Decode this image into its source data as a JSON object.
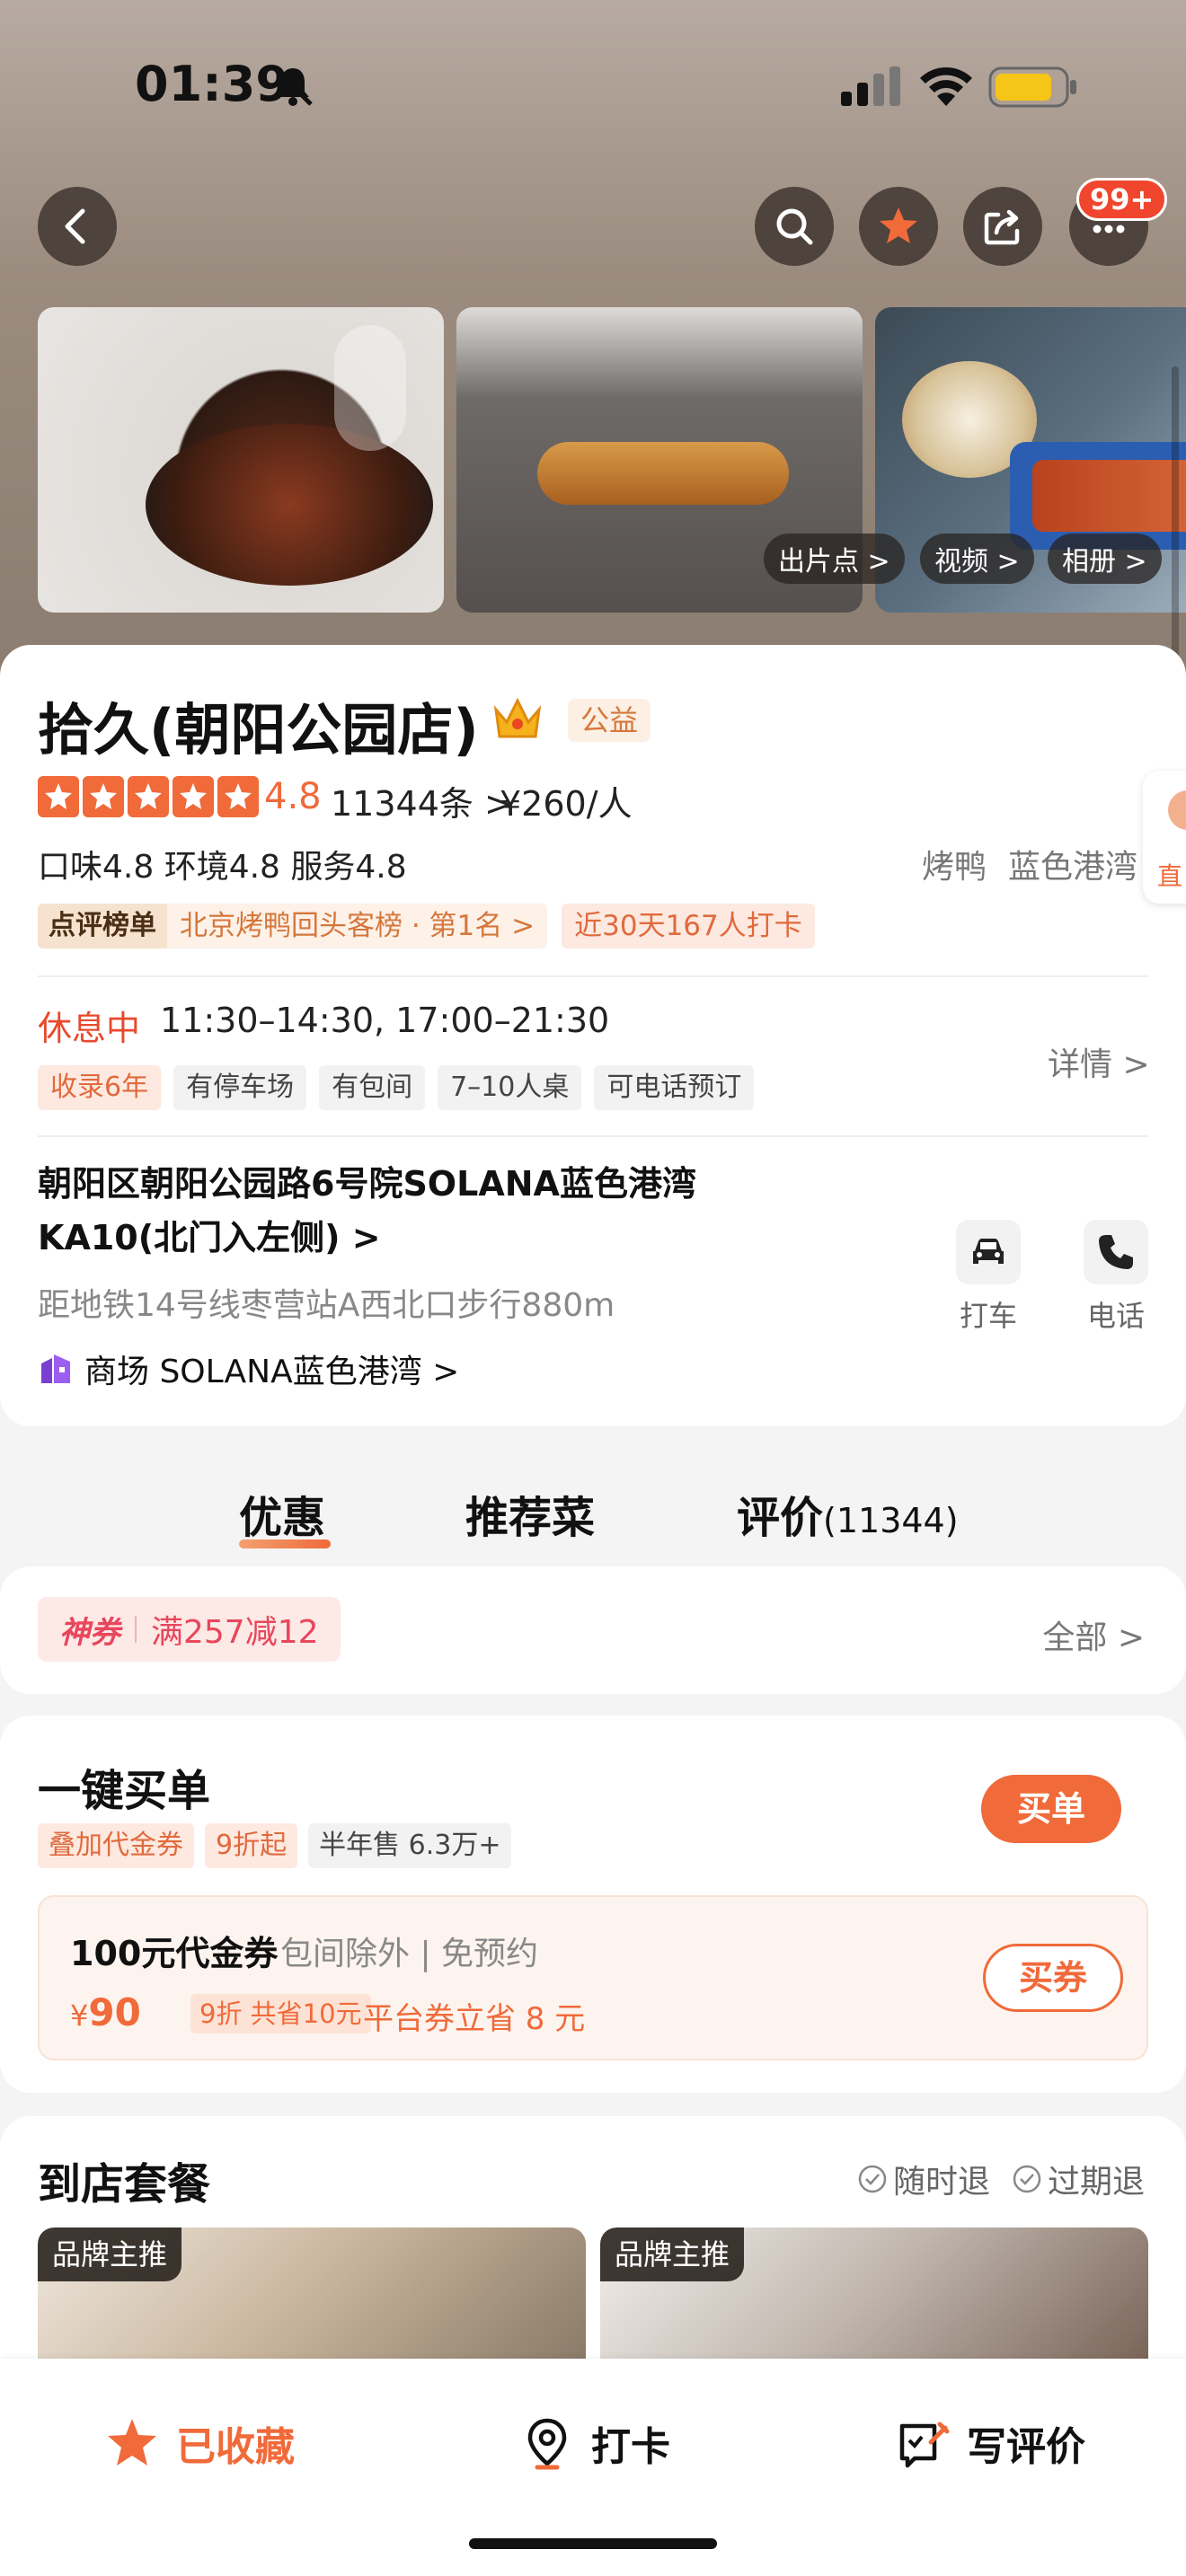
{
  "status_bar": {
    "time": "01:39"
  },
  "header": {
    "badge": "99+"
  },
  "gallery": {
    "tags": [
      "出片点 >",
      "视频 >",
      "相册 >"
    ]
  },
  "shop": {
    "name": "拾久(朝阳公园店)",
    "badge": "公益",
    "rating": "4.8",
    "review_count": "11344条 >",
    "price": "¥260/人",
    "scores": "口味4.8  环境4.8  服务4.8",
    "categories": [
      "烤鸭",
      "蓝色港湾"
    ],
    "side_tab_label": "直",
    "rank_label": "点评榜单",
    "rank_text": "北京烤鸭回头客榜 · 第1名 >",
    "checkins": "近30天167人打卡"
  },
  "hours": {
    "status": "休息中",
    "time": "11:30–14:30, 17:00–21:30",
    "details": "详情 >",
    "features": [
      "收录6年",
      "有停车场",
      "有包间",
      "7–10人桌",
      "可电话预订"
    ]
  },
  "location": {
    "address": "朝阳区朝阳公园路6号院SOLANA蓝色港湾KA10(北门入左侧) >",
    "metro": "距地铁14号线枣营站A西北口步行880m",
    "mall": "商场 SOLANA蓝色港湾 >",
    "actions": {
      "taxi": "打车",
      "phone": "电话"
    }
  },
  "tabs": {
    "deals": "优惠",
    "dishes": "推荐菜",
    "reviews": "评价",
    "reviews_count": "(11344)"
  },
  "coupon": {
    "label": "神券",
    "value": "满257减12",
    "all": "全部 >"
  },
  "quick_pay": {
    "title": "一键买单",
    "tags": [
      "叠加代金券",
      "9折起",
      "半年售 6.3万+"
    ],
    "button": "买单",
    "voucher": {
      "title": "100元代金券",
      "subtitle": "包间除外 | 免预约",
      "currency": "¥",
      "price": "90",
      "discount": "9折 共省10元",
      "saving": "平台券立省 8 元",
      "button": "买券"
    }
  },
  "packages": {
    "title": "到店套餐",
    "policies": [
      "随时退",
      "过期退"
    ],
    "items": [
      {
        "tag": "品牌主推"
      },
      {
        "tag": "品牌主推"
      }
    ]
  },
  "bottom_bar": {
    "favorite": "已收藏",
    "checkin": "打卡",
    "write_review": "写评价"
  },
  "colors": {
    "accent": "#f06a3a",
    "closed_status": "#e84a2c",
    "coupon": "#e8465c"
  }
}
